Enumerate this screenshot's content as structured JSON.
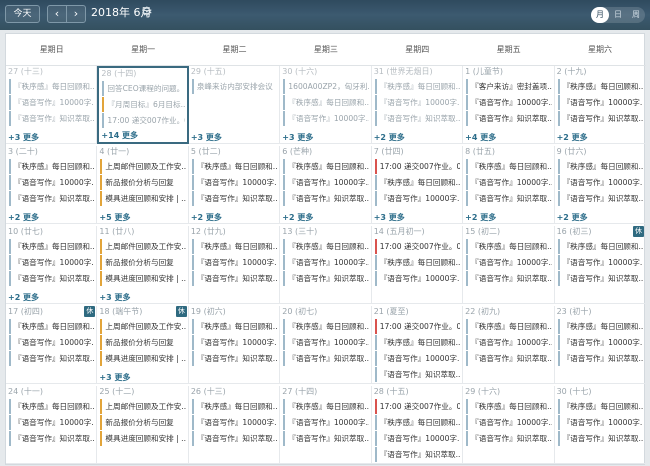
{
  "toolbar": {
    "today": "今天",
    "prev": "‹",
    "next": "›",
    "title": "2018年 6月",
    "gear_icon": "gear-icon"
  },
  "views": [
    "月",
    "日",
    "周"
  ],
  "weekdays": [
    "星期日",
    "星期一",
    "星期二",
    "星期三",
    "星期四",
    "星期五",
    "星期六"
  ],
  "weeks": [
    [
      {
        "label": "27 (十三)",
        "other": true,
        "events": [
          {
            "t": "『秩序感』每日回顾和...",
            "c": "plain"
          },
          {
            "t": "『语音写作』10000字...",
            "c": "plain"
          },
          {
            "t": "『语音写作』知识萃取...",
            "c": "plain"
          }
        ],
        "more": "+3 更多"
      },
      {
        "label": "28 (十四)",
        "other": true,
        "today": true,
        "events": [
          {
            "t": "回答CEO课程的问题。..",
            "c": "plain"
          },
          {
            "t": "『月周目标』6月目标...",
            "c": "orange"
          },
          {
            "t": "17:00 递交007作业。0...",
            "c": "plain"
          }
        ],
        "more": "+14 更多"
      },
      {
        "label": "29 (十五)",
        "other": true,
        "events": [
          {
            "t": "泉峰来访内部安排会议",
            "c": "plain"
          }
        ],
        "more": "+3 更多"
      },
      {
        "label": "30 (十六)",
        "other": true,
        "events": [
          {
            "t": "1600A00ZP2，匈牙利...",
            "c": "plain"
          },
          {
            "t": "『秩序感』每日回顾和...",
            "c": "plain"
          },
          {
            "t": "『语音写作』10000字...",
            "c": "plain"
          }
        ],
        "more": "+3 更多"
      },
      {
        "label": "31 (世界无烟日)",
        "other": true,
        "events": [
          {
            "t": "『秩序感』每日回顾和...",
            "c": "plain"
          },
          {
            "t": "『语音写作』10000字...",
            "c": "plain"
          },
          {
            "t": "『语音写作』知识萃取...",
            "c": "plain"
          }
        ],
        "more": "+2 更多"
      },
      {
        "label": "1 (儿童节)",
        "events": [
          {
            "t": "『客户来访』密封盖项...",
            "c": "plain"
          },
          {
            "t": "『语音写作』10000字...",
            "c": "plain"
          },
          {
            "t": "『语音写作』知识萃取...",
            "c": "plain"
          }
        ],
        "more": "+4 更多"
      },
      {
        "label": "2 (十九)",
        "events": [
          {
            "t": "『秩序感』每日回顾和...",
            "c": "plain"
          },
          {
            "t": "『语音写作』10000字...",
            "c": "plain"
          },
          {
            "t": "『语音写作』知识萃取...",
            "c": "plain"
          }
        ],
        "more": "+2 更多"
      }
    ],
    [
      {
        "label": "3 (二十)",
        "events": [
          {
            "t": "『秩序感』每日回顾和...",
            "c": "plain"
          },
          {
            "t": "『语音写作』10000字...",
            "c": "plain"
          },
          {
            "t": "『语音写作』知识萃取...",
            "c": "plain"
          }
        ],
        "more": "+2 更多"
      },
      {
        "label": "4 (廿一)",
        "events": [
          {
            "t": "上周邮件回顾及工作安...",
            "c": "orange"
          },
          {
            "t": "新品报价分析与回复",
            "c": "orange"
          },
          {
            "t": "模具进度回顾和安排 | ...",
            "c": "orange"
          }
        ],
        "more": "+5 更多"
      },
      {
        "label": "5 (廿二)",
        "events": [
          {
            "t": "『秩序感』每日回顾和...",
            "c": "plain"
          },
          {
            "t": "『语音写作』10000字...",
            "c": "plain"
          },
          {
            "t": "『语音写作』知识萃取...",
            "c": "plain"
          }
        ],
        "more": "+2 更多"
      },
      {
        "label": "6 (芒种)",
        "events": [
          {
            "t": "『秩序感』每日回顾和...",
            "c": "plain"
          },
          {
            "t": "『语音写作』10000字...",
            "c": "plain"
          },
          {
            "t": "『语音写作』知识萃取...",
            "c": "plain"
          }
        ],
        "more": "+2 更多"
      },
      {
        "label": "7 (廿四)",
        "events": [
          {
            "t": "17:00 递交007作业。0...",
            "c": "red"
          },
          {
            "t": "『秩序感』每日回顾和...",
            "c": "plain"
          },
          {
            "t": "『语音写作』10000字...",
            "c": "plain"
          }
        ],
        "more": "+3 更多"
      },
      {
        "label": "8 (廿五)",
        "events": [
          {
            "t": "『秩序感』每日回顾和...",
            "c": "plain"
          },
          {
            "t": "『语音写作』10000字...",
            "c": "plain"
          },
          {
            "t": "『语音写作』知识萃取...",
            "c": "plain"
          }
        ],
        "more": "+2 更多"
      },
      {
        "label": "9 (廿六)",
        "events": [
          {
            "t": "『秩序感』每日回顾和...",
            "c": "plain"
          },
          {
            "t": "『语音写作』10000字...",
            "c": "plain"
          },
          {
            "t": "『语音写作』知识萃取...",
            "c": "plain"
          }
        ],
        "more": "+2 更多"
      }
    ],
    [
      {
        "label": "10 (廿七)",
        "events": [
          {
            "t": "『秩序感』每日回顾和...",
            "c": "plain"
          },
          {
            "t": "『语音写作』10000字...",
            "c": "plain"
          },
          {
            "t": "『语音写作』知识萃取...",
            "c": "plain"
          }
        ],
        "more": "+2 更多"
      },
      {
        "label": "11 (廿八)",
        "events": [
          {
            "t": "上周邮件回顾及工作安...",
            "c": "orange"
          },
          {
            "t": "新品报价分析与回复",
            "c": "orange"
          },
          {
            "t": "模具进度回顾和安排 | ...",
            "c": "orange"
          }
        ],
        "more": "+3 更多"
      },
      {
        "label": "12 (廿九)",
        "events": [
          {
            "t": "『秩序感』每日回顾和...",
            "c": "plain"
          },
          {
            "t": "『语音写作』10000字...",
            "c": "plain"
          },
          {
            "t": "『语音写作』知识萃取...",
            "c": "plain"
          }
        ]
      },
      {
        "label": "13 (三十)",
        "events": [
          {
            "t": "『秩序感』每日回顾和...",
            "c": "plain"
          },
          {
            "t": "『语音写作』10000字...",
            "c": "plain"
          },
          {
            "t": "『语音写作』知识萃取...",
            "c": "plain"
          }
        ]
      },
      {
        "label": "14 (五月初一)",
        "events": [
          {
            "t": "17:00 递交007作业。0...",
            "c": "red"
          },
          {
            "t": "『秩序感』每日回顾和...",
            "c": "plain"
          },
          {
            "t": "『语音写作』10000字...",
            "c": "plain"
          }
        ]
      },
      {
        "label": "15 (初二)",
        "events": [
          {
            "t": "『秩序感』每日回顾和...",
            "c": "plain"
          },
          {
            "t": "『语音写作』10000字...",
            "c": "plain"
          },
          {
            "t": "『语音写作』知识萃取...",
            "c": "plain"
          }
        ]
      },
      {
        "label": "16 (初三)",
        "rest": "休",
        "events": [
          {
            "t": "『秩序感』每日回顾和...",
            "c": "plain"
          },
          {
            "t": "『语音写作』10000字...",
            "c": "plain"
          },
          {
            "t": "『语音写作』知识萃取...",
            "c": "plain"
          }
        ]
      }
    ],
    [
      {
        "label": "17 (初四)",
        "rest": "休",
        "events": [
          {
            "t": "『秩序感』每日回顾和...",
            "c": "plain"
          },
          {
            "t": "『语音写作』10000字...",
            "c": "plain"
          },
          {
            "t": "『语音写作』知识萃取...",
            "c": "plain"
          }
        ]
      },
      {
        "label": "18 (端午节)",
        "rest": "休",
        "events": [
          {
            "t": "上周邮件回顾及工作安...",
            "c": "orange"
          },
          {
            "t": "新品报价分析与回复",
            "c": "orange"
          },
          {
            "t": "模具进度回顾和安排 | ...",
            "c": "orange"
          }
        ],
        "more": "+3 更多"
      },
      {
        "label": "19 (初六)",
        "events": [
          {
            "t": "『秩序感』每日回顾和...",
            "c": "plain"
          },
          {
            "t": "『语音写作』10000字...",
            "c": "plain"
          },
          {
            "t": "『语音写作』知识萃取...",
            "c": "plain"
          }
        ]
      },
      {
        "label": "20 (初七)",
        "events": [
          {
            "t": "『秩序感』每日回顾和...",
            "c": "plain"
          },
          {
            "t": "『语音写作』10000字...",
            "c": "plain"
          },
          {
            "t": "『语音写作』知识萃取...",
            "c": "plain"
          }
        ]
      },
      {
        "label": "21 (夏至)",
        "events": [
          {
            "t": "17:00 递交007作业。0...",
            "c": "red"
          },
          {
            "t": "『秩序感』每日回顾和...",
            "c": "plain"
          },
          {
            "t": "『语音写作』10000字...",
            "c": "plain"
          },
          {
            "t": "『语音写作』知识萃取...",
            "c": "plain"
          }
        ]
      },
      {
        "label": "22 (初九)",
        "events": [
          {
            "t": "『秩序感』每日回顾和...",
            "c": "plain"
          },
          {
            "t": "『语音写作』10000字...",
            "c": "plain"
          },
          {
            "t": "『语音写作』知识萃取...",
            "c": "plain"
          }
        ]
      },
      {
        "label": "23 (初十)",
        "events": [
          {
            "t": "『秩序感』每日回顾和...",
            "c": "plain"
          },
          {
            "t": "『语音写作』10000字...",
            "c": "plain"
          },
          {
            "t": "『语音写作』知识萃取...",
            "c": "plain"
          }
        ]
      }
    ],
    [
      {
        "label": "24 (十一)",
        "events": [
          {
            "t": "『秩序感』每日回顾和...",
            "c": "plain"
          },
          {
            "t": "『语音写作』10000字...",
            "c": "plain"
          },
          {
            "t": "『语音写作』知识萃取...",
            "c": "plain"
          }
        ]
      },
      {
        "label": "25 (十二)",
        "events": [
          {
            "t": "上周邮件回顾及工作安...",
            "c": "orange"
          },
          {
            "t": "新品报价分析与回复",
            "c": "orange"
          },
          {
            "t": "模具进度回顾和安排 | ...",
            "c": "orange"
          }
        ]
      },
      {
        "label": "26 (十三)",
        "events": [
          {
            "t": "『秩序感』每日回顾和...",
            "c": "plain"
          },
          {
            "t": "『语音写作』10000字...",
            "c": "plain"
          },
          {
            "t": "『语音写作』知识萃取...",
            "c": "plain"
          }
        ]
      },
      {
        "label": "27 (十四)",
        "events": [
          {
            "t": "『秩序感』每日回顾和...",
            "c": "plain"
          },
          {
            "t": "『语音写作』10000字...",
            "c": "plain"
          },
          {
            "t": "『语音写作』知识萃取...",
            "c": "plain"
          }
        ]
      },
      {
        "label": "28 (十五)",
        "events": [
          {
            "t": "17:00 递交007作业。0...",
            "c": "red"
          },
          {
            "t": "『秩序感』每日回顾和...",
            "c": "plain"
          },
          {
            "t": "『语音写作』10000字...",
            "c": "plain"
          },
          {
            "t": "『语音写作』知识萃取...",
            "c": "plain"
          }
        ]
      },
      {
        "label": "29 (十六)",
        "events": [
          {
            "t": "『秩序感』每日回顾和...",
            "c": "plain"
          },
          {
            "t": "『语音写作』10000字...",
            "c": "plain"
          },
          {
            "t": "『语音写作』知识萃取...",
            "c": "plain"
          }
        ]
      },
      {
        "label": "30 (十七)",
        "events": [
          {
            "t": "『秩序感』每日回顾和...",
            "c": "plain"
          },
          {
            "t": "『语音写作』10000字...",
            "c": "plain"
          },
          {
            "t": "『语音写作』知识萃取...",
            "c": "plain"
          }
        ]
      }
    ]
  ]
}
